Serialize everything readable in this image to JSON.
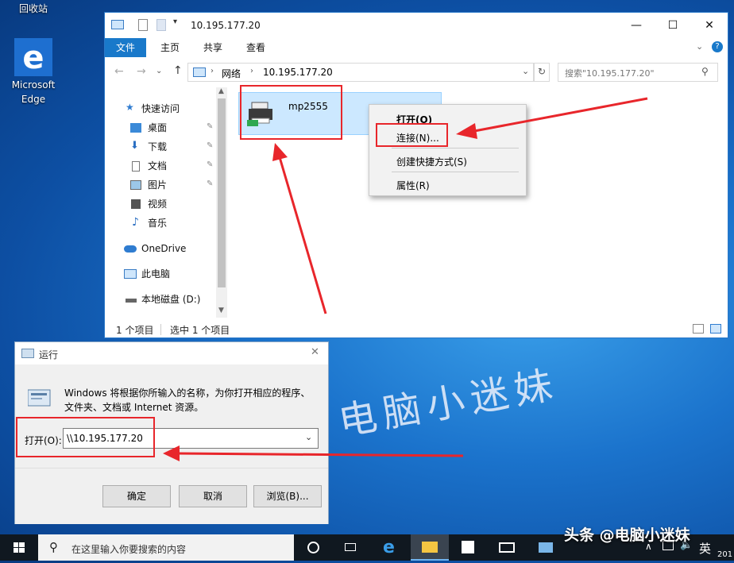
{
  "desktop": {
    "recycle_bin_label": "回收站",
    "edge_label_line1": "Microsoft",
    "edge_label_line2": "Edge"
  },
  "explorer": {
    "title": "10.195.177.20",
    "ribbon_tabs": [
      "文件",
      "主页",
      "共享",
      "查看"
    ],
    "breadcrumb": [
      "网络",
      "10.195.177.20"
    ],
    "search_placeholder": "搜索\"10.195.177.20\"",
    "nav_items": [
      {
        "label": "快速访问",
        "icon": "star-icon"
      },
      {
        "label": "桌面",
        "icon": "desktop-icon"
      },
      {
        "label": "下载",
        "icon": "download-icon"
      },
      {
        "label": "文档",
        "icon": "document-icon"
      },
      {
        "label": "图片",
        "icon": "picture-icon"
      },
      {
        "label": "视频",
        "icon": "video-icon"
      },
      {
        "label": "音乐",
        "icon": "music-icon"
      },
      {
        "label": "OneDrive",
        "icon": "cloud-icon"
      },
      {
        "label": "此电脑",
        "icon": "computer-icon"
      },
      {
        "label": "本地磁盘 (D:)",
        "icon": "drive-icon"
      }
    ],
    "printer_name": "mp2555",
    "status_count": "1 个项目",
    "status_selected": "选中 1 个项目"
  },
  "context_menu": {
    "items": [
      "打开(O)",
      "连接(N)...",
      "创建快捷方式(S)",
      "属性(R)"
    ]
  },
  "run_dialog": {
    "title": "运行",
    "description_line1": "Windows 将根据你所输入的名称，为你打开相应的程序、",
    "description_line2": "文件夹、文档或 Internet 资源。",
    "open_label": "打开(O):",
    "open_value": "\\\\10.195.177.20",
    "ok_label": "确定",
    "cancel_label": "取消",
    "browse_label": "浏览(B)..."
  },
  "watermark": "电脑小迷妹",
  "taskbar": {
    "search_placeholder": "在这里输入你要搜索的内容",
    "ime_label": "英",
    "clock_fragment": "201",
    "brand_text": "头条 @电脑小迷妹"
  },
  "colors": {
    "accent": "#1979ca",
    "annotation_red": "#e8262b",
    "taskbar": "#101820"
  }
}
